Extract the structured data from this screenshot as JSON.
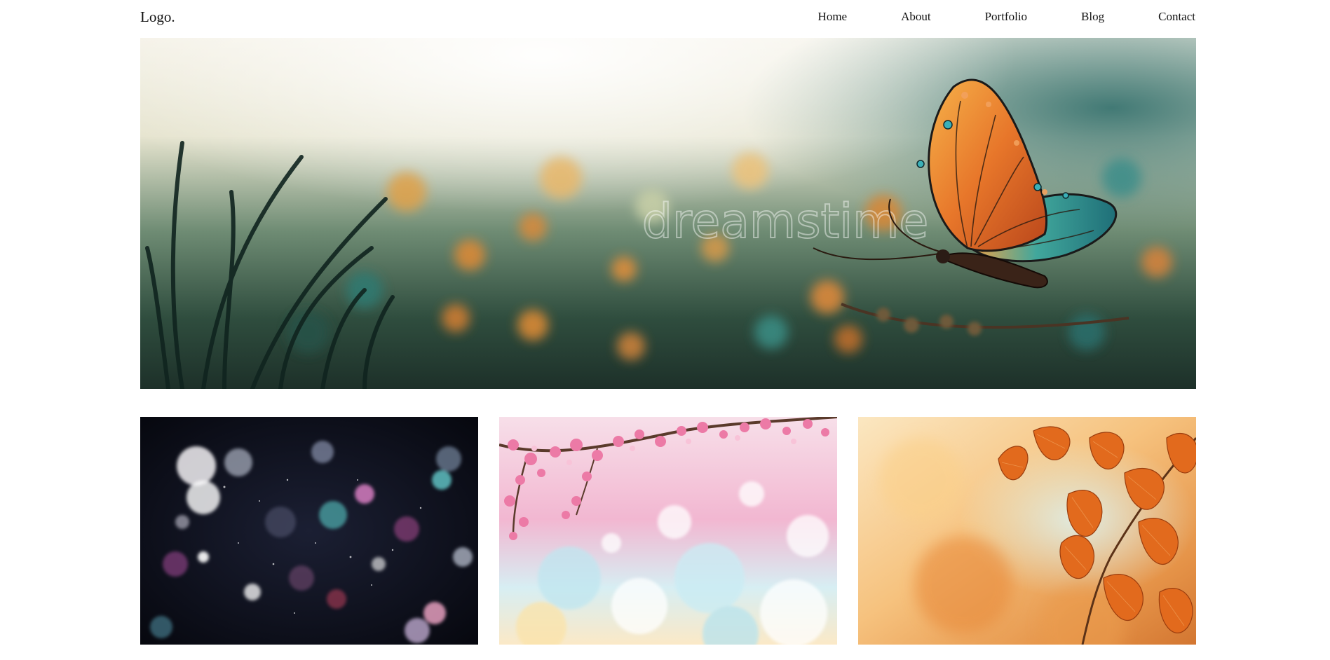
{
  "header": {
    "logo": "Logo.",
    "nav": [
      {
        "label": "Home"
      },
      {
        "label": "About"
      },
      {
        "label": "Portfolio"
      },
      {
        "label": "Blog"
      },
      {
        "label": "Contact"
      }
    ]
  },
  "hero": {
    "watermark": "dreamstime"
  },
  "gallery": [
    {
      "image": "bokeh-lights-image"
    },
    {
      "image": "cherry-blossom-image"
    },
    {
      "image": "autumn-leaves-image"
    }
  ]
}
